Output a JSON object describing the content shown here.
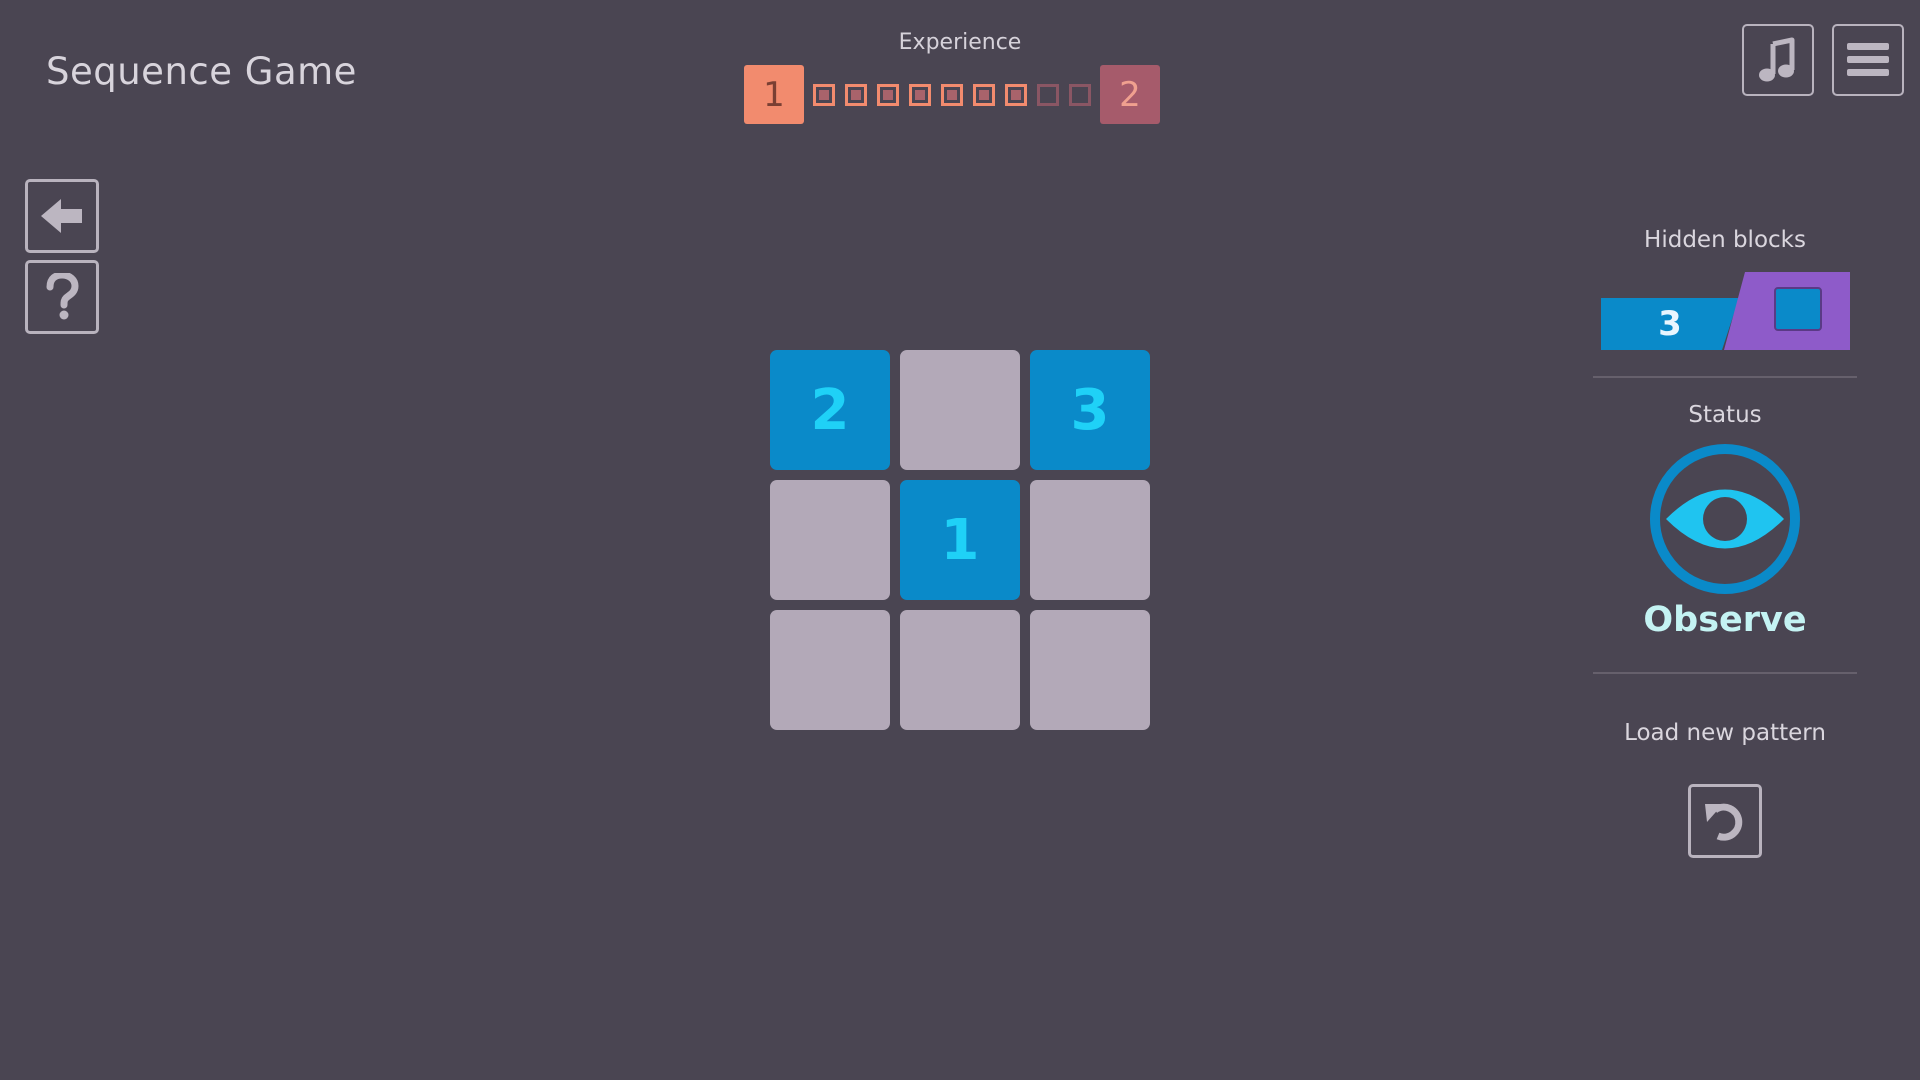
{
  "app": {
    "title": "Sequence Game"
  },
  "experience": {
    "label": "Experience",
    "current_level": "1",
    "next_level": "2",
    "ticks_total": 9,
    "ticks_filled": 7
  },
  "toolbar": {
    "music_icon": "music-note-icon",
    "menu_icon": "hamburger-menu-icon"
  },
  "side_buttons": {
    "back_icon": "arrow-left-icon",
    "help_icon": "question-mark-icon"
  },
  "grid": {
    "rows": 3,
    "cols": 3,
    "cells": [
      "2",
      "",
      "3",
      "",
      "1",
      "",
      "",
      "",
      ""
    ],
    "lit": [
      true,
      false,
      true,
      false,
      true,
      false,
      false,
      false,
      false
    ]
  },
  "hidden_blocks": {
    "label": "Hidden blocks",
    "count": "3"
  },
  "status": {
    "label": "Status",
    "value": "Observe",
    "icon": "eye-icon"
  },
  "reload": {
    "label": "Load new pattern",
    "icon": "reload-icon"
  },
  "colors": {
    "background": "#4a4552",
    "tile_lit": "#0a8ac9",
    "tile_unlit": "#b3a9b8",
    "tile_number": "#1fd1f7",
    "level_current": "#f28b6e",
    "level_next": "#a65b6b",
    "hidden_blocks_blue": "#0a8ac9",
    "hidden_blocks_purple": "#8e5bc9"
  }
}
